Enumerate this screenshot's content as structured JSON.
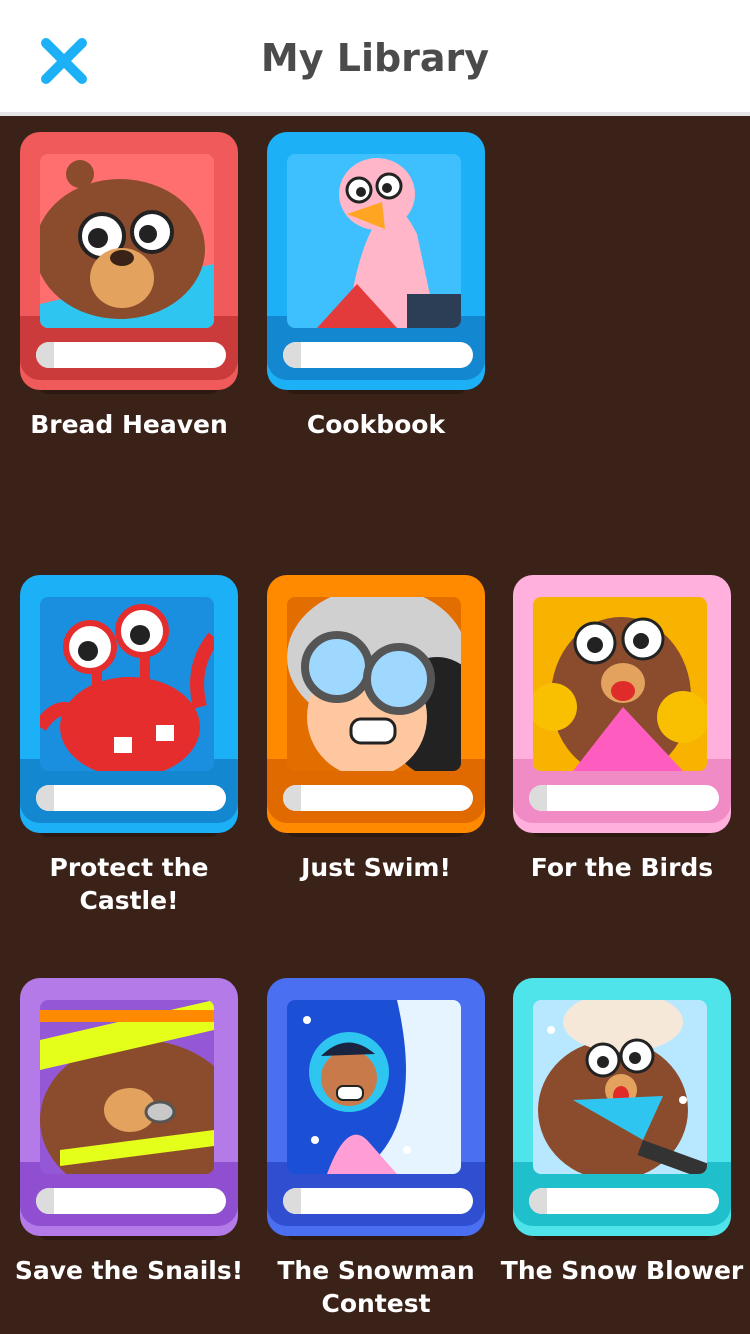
{
  "header": {
    "title": "My Library",
    "close_icon": "close-icon",
    "accent": "#1cb0f6"
  },
  "books": [
    {
      "title": "Bread Heaven",
      "cover_color": "#f05a5a",
      "spine_color": "#cc3b3b",
      "art": "bread-heaven-cover-art"
    },
    {
      "title": "Cookbook",
      "cover_color": "#1cb0f6",
      "spine_color": "#1487d1",
      "art": "cookbook-cover-art"
    },
    {
      "title": "Protect the Castle!",
      "cover_color": "#1cb0f6",
      "spine_color": "#1487d1",
      "art": "protect-the-castle-cover-art"
    },
    {
      "title": "Just Swim!",
      "cover_color": "#ff8a00",
      "spine_color": "#e06a00",
      "art": "just-swim-cover-art"
    },
    {
      "title": "For the Birds",
      "cover_color": "#ffb0dc",
      "spine_color": "#f08bc6",
      "art": "for-the-birds-cover-art"
    },
    {
      "title": "Save the Snails!",
      "cover_color": "#b37ae8",
      "spine_color": "#8f4fd0",
      "art": "save-the-snails-cover-art"
    },
    {
      "title": "The Snowman Contest",
      "cover_color": "#4a6ff0",
      "spine_color": "#2f4fd0",
      "art": "the-snowman-contest-cover-art"
    },
    {
      "title": "The Snow Blower",
      "cover_color": "#4fe3ea",
      "spine_color": "#1fc0cc",
      "art": "the-snow-blower-cover-art"
    }
  ]
}
